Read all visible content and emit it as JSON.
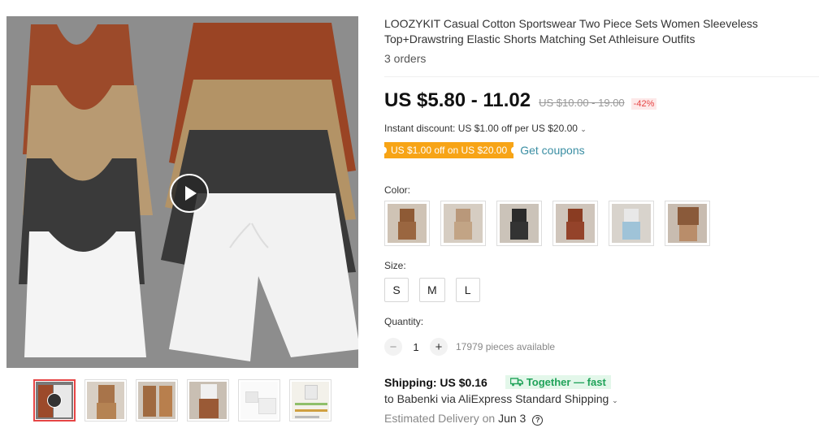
{
  "product": {
    "title": "LOOZYKIT Casual Cotton Sportswear Two Piece Sets Women Sleeveless Top+Drawstring Elastic Shorts Matching Set Athleisure Outfits",
    "orders": "3 orders"
  },
  "pricing": {
    "price": "US $5.80 - 11.02",
    "original_price": "US $10.00 - 19.00",
    "discount": "-42%",
    "instant_discount": "Instant discount: US $1.00 off per US $20.00",
    "coupon_tag": "US $1.00 off on US $20.00",
    "get_coupons": "Get coupons"
  },
  "options": {
    "color_label": "Color:",
    "color_swatches": [
      "brown-set",
      "beige-set",
      "black-set",
      "rust-set",
      "light-blue-set",
      "brown-top-set"
    ],
    "size_label": "Size:",
    "sizes": [
      "S",
      "M",
      "L"
    ],
    "quantity_label": "Quantity:",
    "quantity": "1",
    "decrement": "−",
    "increment": "+",
    "available": "17979 pieces available"
  },
  "shipping": {
    "label": "Shipping: US $0.16",
    "badge": "Together — fast",
    "to": "to Babenki via AliExpress Standard Shipping",
    "delivery_prefix": "Estimated Delivery on",
    "delivery_date": "Jun 3"
  },
  "colors": {
    "accent_red": "#e64545",
    "coupon_orange": "#f7a416",
    "link_teal": "#3a8ea3",
    "ship_green": "#21a35a"
  }
}
